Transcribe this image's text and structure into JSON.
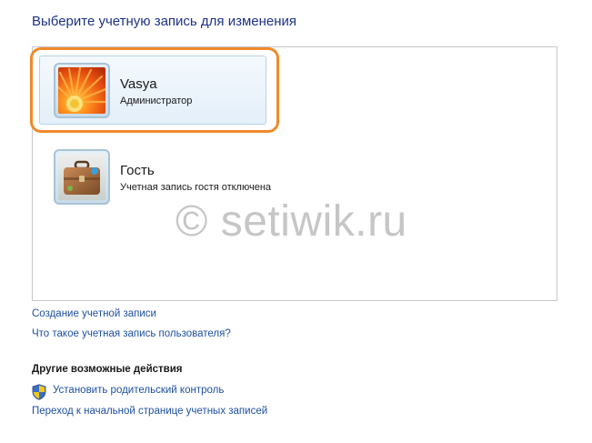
{
  "page": {
    "title": "Выберите учетную запись для изменения"
  },
  "accounts": [
    {
      "name": "Vasya",
      "role": "Администратор",
      "avatar": "orange-flower-avatar",
      "selected": true
    },
    {
      "name": "Гость",
      "role": "Учетная запись гостя отключена",
      "avatar": "suitcase-avatar",
      "selected": false
    }
  ],
  "watermark": "© setiwik.ru",
  "links": {
    "create_account": "Создание учетной записи",
    "what_is_account": "Что такое учетная запись пользователя?"
  },
  "other_actions": {
    "heading": "Другие возможные действия",
    "parental_control": {
      "label": "Установить родительский контроль",
      "icon": "uac-shield-icon"
    },
    "accounts_home": "Переход к начальной странице учетных записей"
  },
  "colors": {
    "highlight": "#f08a2a",
    "link": "#1e50a2",
    "title": "#1e3287"
  }
}
